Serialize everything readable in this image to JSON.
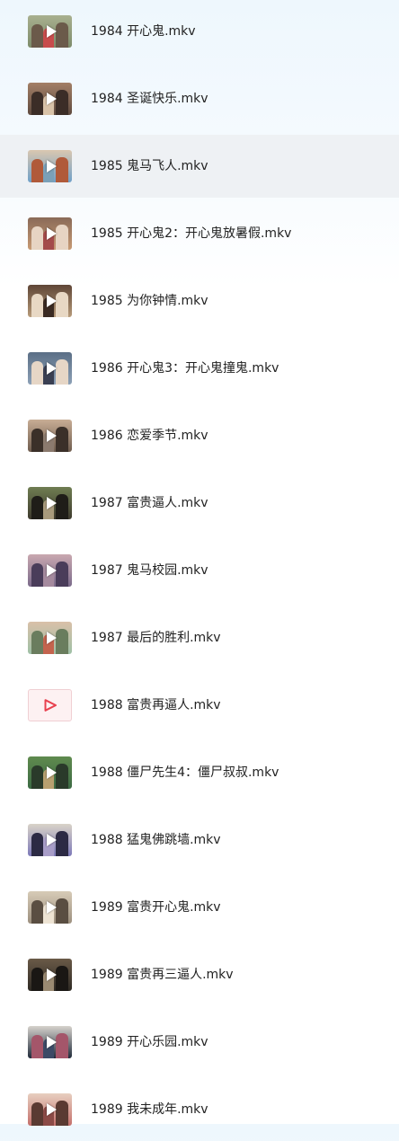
{
  "files": [
    {
      "name": "1984 开心鬼.mkv",
      "thumbnail": "video-thumbnail-icon"
    },
    {
      "name": "1984 圣诞快乐.mkv",
      "thumbnail": "video-thumbnail-icon"
    },
    {
      "name": "1985 鬼马飞人.mkv",
      "thumbnail": "video-thumbnail-icon"
    },
    {
      "name": "1985 开心鬼2：开心鬼放暑假.mkv",
      "thumbnail": "video-thumbnail-icon"
    },
    {
      "name": "1985 为你钟情.mkv",
      "thumbnail": "video-thumbnail-icon"
    },
    {
      "name": "1986 开心鬼3：开心鬼撞鬼.mkv",
      "thumbnail": "video-thumbnail-icon"
    },
    {
      "name": "1986 恋爱季节.mkv",
      "thumbnail": "video-thumbnail-icon"
    },
    {
      "name": "1987 富贵逼人.mkv",
      "thumbnail": "video-thumbnail-icon"
    },
    {
      "name": "1987 鬼马校园.mkv",
      "thumbnail": "video-thumbnail-icon"
    },
    {
      "name": "1987 最后的胜利.mkv",
      "thumbnail": "video-thumbnail-icon"
    },
    {
      "name": "1988 富贵再逼人.mkv",
      "thumbnail": "video-placeholder-icon"
    },
    {
      "name": "1988 僵尸先生4：僵尸叔叔.mkv",
      "thumbnail": "video-thumbnail-icon"
    },
    {
      "name": "1988 猛鬼佛跳墙.mkv",
      "thumbnail": "video-thumbnail-icon"
    },
    {
      "name": "1989 富贵开心鬼.mkv",
      "thumbnail": "video-thumbnail-icon"
    },
    {
      "name": "1989 富贵再三逼人.mkv",
      "thumbnail": "video-thumbnail-icon"
    },
    {
      "name": "1989 开心乐园.mkv",
      "thumbnail": "video-thumbnail-icon"
    },
    {
      "name": "1989 我未成年.mkv",
      "thumbnail": "video-thumbnail-icon"
    }
  ],
  "selected_index": 2,
  "colors": {
    "selected_row": "#eef1f4",
    "placeholder_accent": "#e8414f"
  }
}
